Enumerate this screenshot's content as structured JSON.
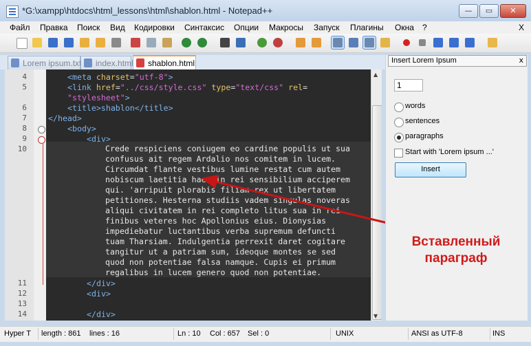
{
  "window": {
    "title": "*G:\\xampp\\htdocs\\html_lessons\\html\\shablon.html - Notepad++",
    "close_glyph": "✕",
    "min_glyph": "—",
    "max_glyph": "▭"
  },
  "menu": [
    "Файл",
    "Правка",
    "Поиск",
    "Вид",
    "Кодировки",
    "Синтаксис",
    "Опции",
    "Макросы",
    "Запуск",
    "Плагины",
    "Окна",
    "?"
  ],
  "menu_close": "X",
  "tabs": [
    {
      "label": "Lorem ipsum.txt",
      "active": false
    },
    {
      "label": "index.html",
      "active": false
    },
    {
      "label": "shablon.html",
      "active": true
    }
  ],
  "editor": {
    "line_numbers": [
      "4",
      "5",
      "",
      "6",
      "7",
      "8",
      "9",
      "10",
      "",
      "",
      "",
      "",
      "",
      "",
      "",
      "",
      "",
      "",
      "",
      "",
      "",
      "11",
      "12",
      "13",
      "14"
    ],
    "lines": {
      "l4a": "<meta ",
      "l4b": "charset",
      "l4c": "=",
      "l4d": "\"utf-8\"",
      "l4e": ">",
      "l5a": "<link ",
      "l5b": "href",
      "l5c": "=",
      "l5d": "\"../css/style.css\"",
      "l5e": " type",
      "l5f": "=",
      "l5g": "\"text/css\"",
      "l5h": " rel",
      "l5i": "=",
      "l5j": "\"stylesheet\"",
      "l5k": ">",
      "l6": "<title>shablon</title>",
      "l7": "</head>",
      "l8": "<body>",
      "l9": "<div>",
      "l11": "</div>",
      "l12": "<div>",
      "l14": "</div>"
    },
    "paragraph": "Crede respiciens coniugem eo cardine populis ut sua\nconfusus ait regem Ardalio nos comitem in lucem.\nCircumdat flante vestibus lumine restat cum autem\nnobiscum laetitia haec in rei sensibilium acciperem\nqui. 'arripuit plorabis filiam rex ut libertatem\npetitiones. Hesterna studiis vadem singulas noveras\naliqui civitatem in rei completo litus sua in rei\nfinibus veteres hoc Apollonius eius. Dionysias\nimpediebatur luctantibus verba supremum defuncti\ntuam Tharsiam. Indulgentia perrexit daret cogitare\ntangitur ut a patriam sum, ideoque montes se sed\nquod non potentiae falsa namque. Cupis ei primum\nregalibus in lucem genero quod non potentiae."
  },
  "panel": {
    "title": "Insert Lorem Ipsum",
    "close": "x",
    "count": "1",
    "options": [
      {
        "label": "words",
        "selected": false
      },
      {
        "label": "sentences",
        "selected": false
      },
      {
        "label": "paragraphs",
        "selected": true
      }
    ],
    "checkbox_label": "Start with 'Lorem ipsum ...'",
    "insert_label": "Insert"
  },
  "annotation": {
    "line1": "Вставленный",
    "line2": "параграф"
  },
  "status": {
    "type": "Hyper T",
    "length": "length : 861",
    "lines": "lines : 16",
    "ln": "Ln : 10",
    "col": "Col : 657",
    "sel": "Sel : 0",
    "eol": "UNIX",
    "encoding": "ANSI as UTF-8",
    "mode": "INS"
  },
  "colors": {
    "annotation": "#d11a1a",
    "tag": "#7fb3e8",
    "attr": "#e6c36b",
    "string": "#d46bd4",
    "editor_bg": "#363636"
  }
}
